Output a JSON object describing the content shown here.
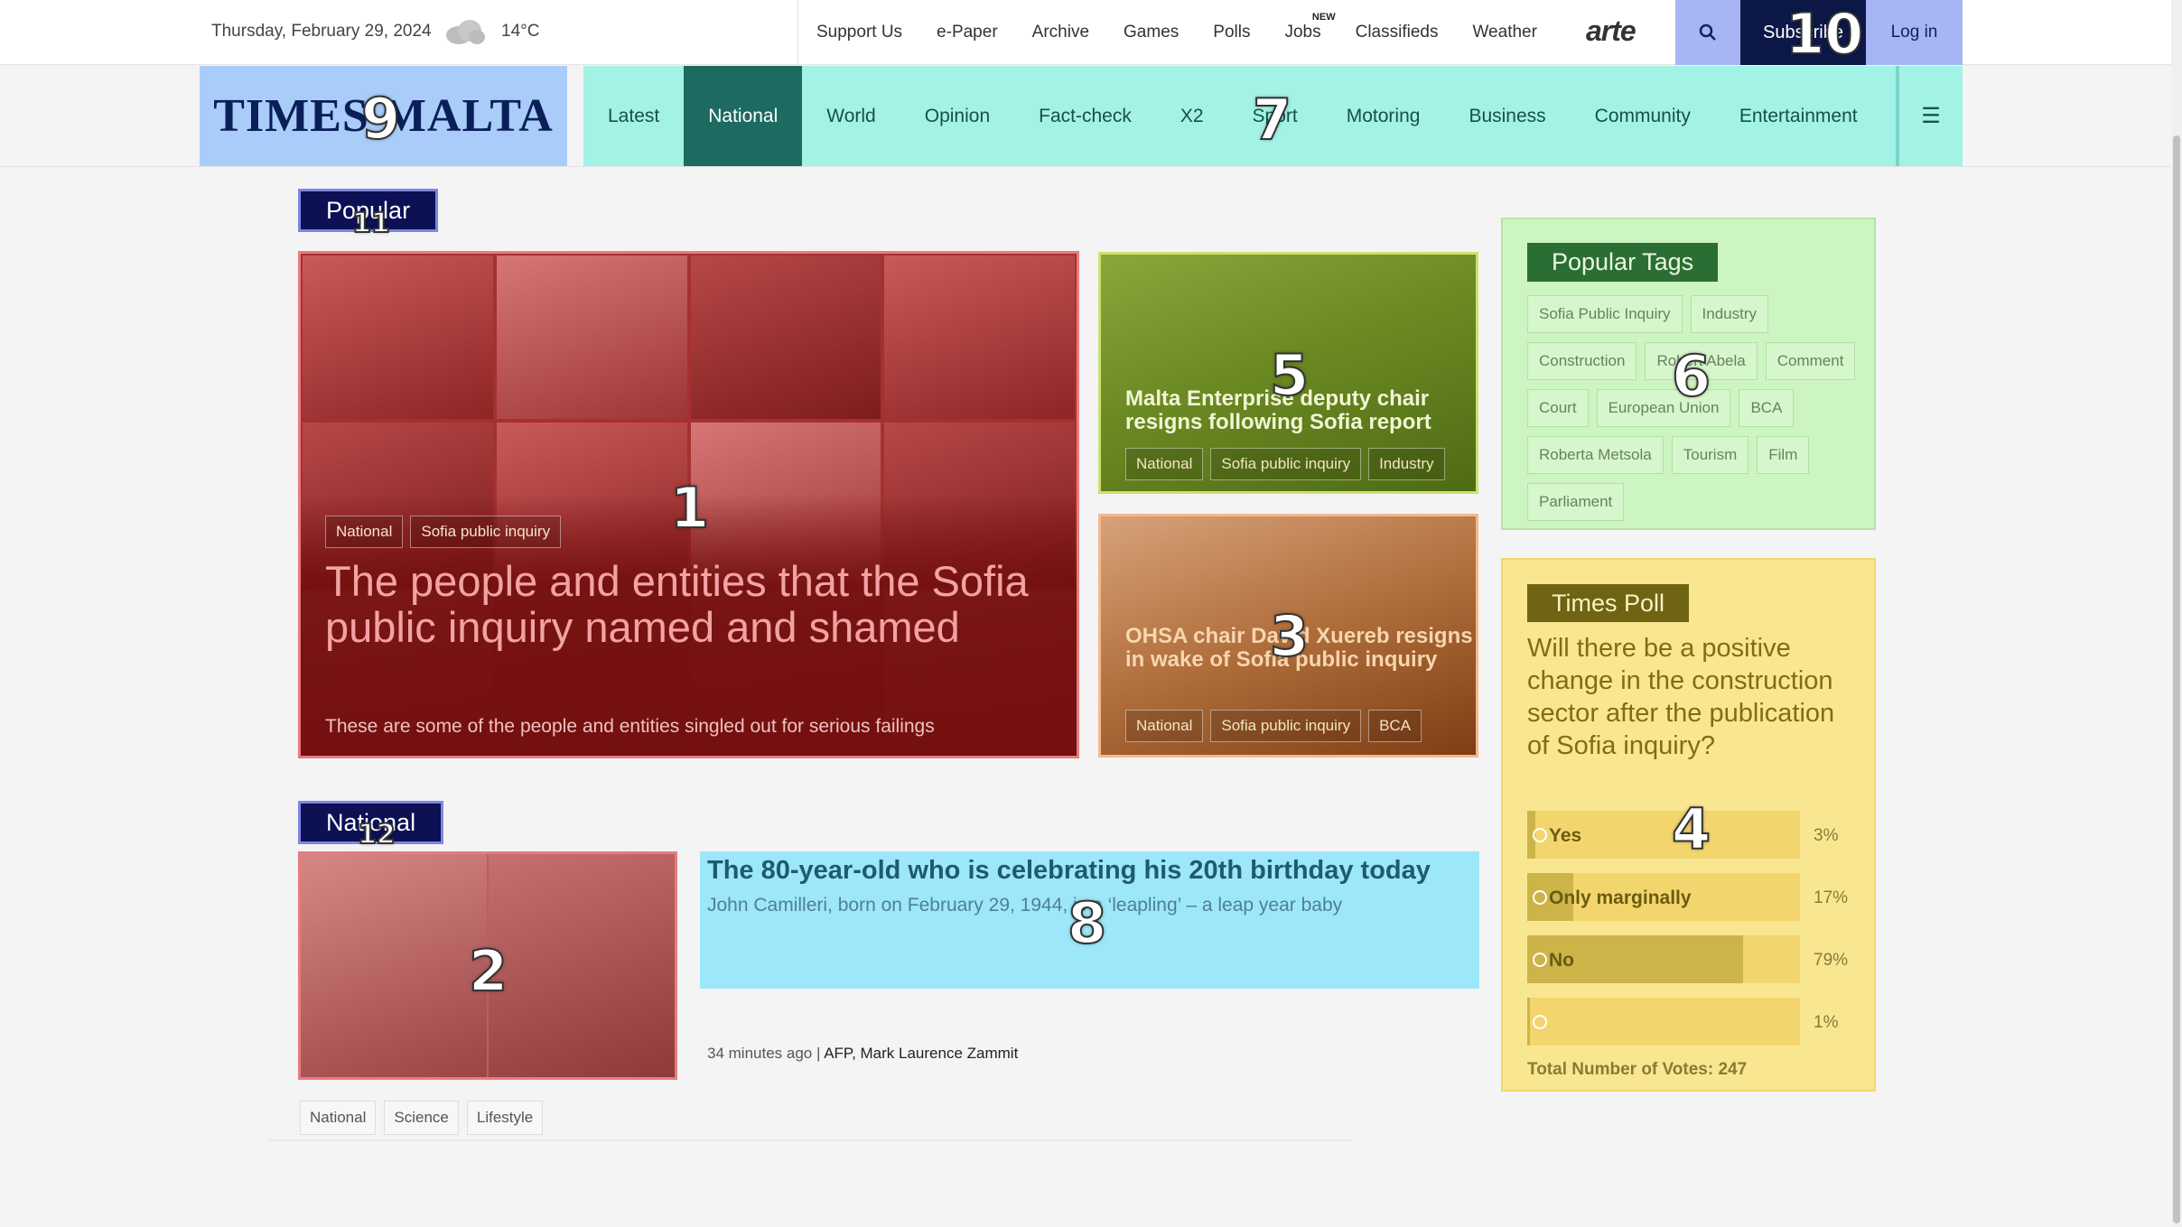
{
  "topbar": {
    "date": "Thursday, February 29, 2024",
    "weather_icon": "cloud-icon",
    "temperature": "14°C",
    "links": [
      "Support Us",
      "e-Paper",
      "Archive",
      "Games",
      "Polls",
      "Jobs",
      "Classifieds",
      "Weather"
    ],
    "jobs_badge": "NEW",
    "partner_logo": "arte",
    "search_icon": "search-icon",
    "subscribe_label": "Subscribe",
    "login_label": "Log in"
  },
  "masthead": {
    "logo_text": "TIMES MALTA",
    "nav": [
      "Latest",
      "National",
      "World",
      "Opinion",
      "Fact-check",
      "X2",
      "Sport",
      "Motoring",
      "Business",
      "Community",
      "Entertainment"
    ],
    "active_nav": "National",
    "menu_icon": "hamburger-menu-icon"
  },
  "popular": {
    "section_label": "Popular",
    "feature": {
      "tags": [
        "National",
        "Sofia public inquiry"
      ],
      "headline": "The people and entities that the Sofia public inquiry named and shamed",
      "dek": "These are some of the people and entities singled out for serious failings"
    },
    "card_top": {
      "headline": "Malta Enterprise deputy chair resigns following Sofia report",
      "tags": [
        "National",
        "Sofia public inquiry",
        "Industry"
      ]
    },
    "card_bottom": {
      "headline": "OHSA chair David Xuereb resigns in wake of Sofia public inquiry",
      "tags": [
        "National",
        "Sofia public inquiry",
        "BCA"
      ]
    }
  },
  "popular_tags": {
    "title": "Popular Tags",
    "tags": [
      "Sofia Public Inquiry",
      "Industry",
      "Construction",
      "Robert Abela",
      "Comment",
      "Court",
      "European Union",
      "BCA",
      "Roberta Metsola",
      "Tourism",
      "Film",
      "Parliament"
    ]
  },
  "poll": {
    "title": "Times Poll",
    "question": "Will there be a positive change in the construction sector after the publication of Sofia inquiry?",
    "options": [
      {
        "label": "Yes",
        "percent": "3%",
        "share": 0.03
      },
      {
        "label": "Only marginally",
        "percent": "17%",
        "share": 0.17
      },
      {
        "label": "No",
        "percent": "79%",
        "share": 0.79
      },
      {
        "label": "",
        "percent": "1%",
        "share": 0.01
      }
    ],
    "total": "Total Number of Votes: 247"
  },
  "national": {
    "section_label": "National",
    "headline": "The 80-year-old who is celebrating his 20th birthday today",
    "dek": "John Camilleri, born on February 29, 1944, is a ‘leapling’ – a leap year baby",
    "time_ago": "34 minutes ago",
    "byline_sep": "|",
    "authors": "AFP, Mark Laurence Zammit",
    "tags": [
      "National",
      "Science",
      "Lifestyle"
    ]
  },
  "markers": [
    "1",
    "2",
    "3",
    "4",
    "5",
    "6",
    "7",
    "8",
    "9",
    "10",
    "11",
    "12"
  ]
}
